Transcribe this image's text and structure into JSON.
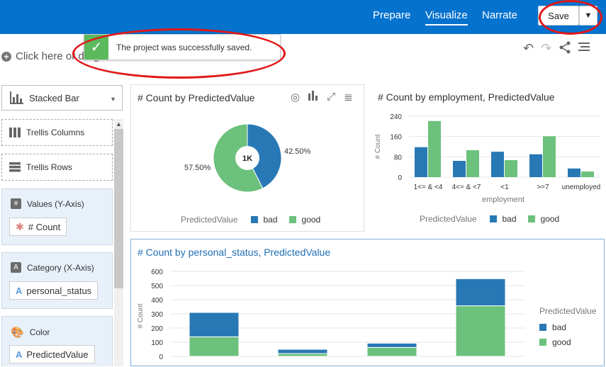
{
  "topbar": {
    "nav": [
      "Prepare",
      "Visualize",
      "Narrate"
    ],
    "save_label": "Save",
    "dropdown_icon": "caret-down"
  },
  "toolbar": {
    "add_text": "Click here or drag",
    "icons": [
      "undo-icon",
      "redo-icon",
      "share-icon",
      "menu-icon"
    ]
  },
  "toast": {
    "message": "The project was successfully saved."
  },
  "left_panel": {
    "viz_type": "Stacked Bar",
    "trellis_columns": "Trellis Columns",
    "trellis_rows": "Trellis Rows",
    "values_label": "Values (Y-Axis)",
    "values_item": "# Count",
    "category_label": "Category (X-Axis)",
    "category_item": "personal_status",
    "color_label": "Color",
    "color_item": "PredictedValue"
  },
  "colors": {
    "bad": "#2878b5",
    "good": "#6cc17c",
    "brand": "#0572ce"
  },
  "charts": {
    "pie": {
      "title": "# Count by PredictedValue",
      "center": "1K",
      "legend_title": "PredictedValue",
      "legend": [
        "bad",
        "good"
      ],
      "labels": [
        "42.50%",
        "57.50%"
      ]
    },
    "employment": {
      "title": "# Count by employment, PredictedValue",
      "xlabel": "employment",
      "ylabel": "# Count",
      "legend_title": "PredictedValue",
      "legend": [
        "bad",
        "good"
      ]
    },
    "personal": {
      "title": "# Count by personal_status, PredictedValue",
      "ylabel": "# Count",
      "legend_title": "PredictedValue",
      "legend": [
        "bad",
        "good"
      ]
    }
  },
  "chart_data": [
    {
      "type": "pie",
      "title": "# Count by PredictedValue",
      "center_label": "1K",
      "categories": [
        "bad",
        "good"
      ],
      "values": [
        42.5,
        57.5
      ]
    },
    {
      "type": "bar",
      "title": "# Count by employment, PredictedValue",
      "xlabel": "employment",
      "ylabel": "# Count",
      "ylim": [
        0,
        240
      ],
      "yticks": [
        0,
        80,
        160,
        240
      ],
      "categories": [
        "1<= & <4",
        "4<= & <7",
        "<1",
        ">=7",
        "unemployed"
      ],
      "series": [
        {
          "name": "bad",
          "values": [
            118,
            64,
            100,
            90,
            34
          ]
        },
        {
          "name": "good",
          "values": [
            221,
            106,
            67,
            161,
            22
          ]
        }
      ],
      "legend_title": "PredictedValue"
    },
    {
      "type": "bar",
      "stacked": true,
      "title": "# Count by personal_status, PredictedValue",
      "ylabel": "# Count",
      "ylim": [
        0,
        600
      ],
      "yticks": [
        0,
        100,
        200,
        300,
        400,
        500,
        600
      ],
      "categories": [
        "",
        "",
        "",
        ""
      ],
      "series": [
        {
          "name": "good",
          "values": [
            138,
            20,
            63,
            357
          ]
        },
        {
          "name": "bad",
          "values": [
            172,
            30,
            30,
            191
          ]
        }
      ],
      "legend_title": "PredictedValue"
    }
  ]
}
